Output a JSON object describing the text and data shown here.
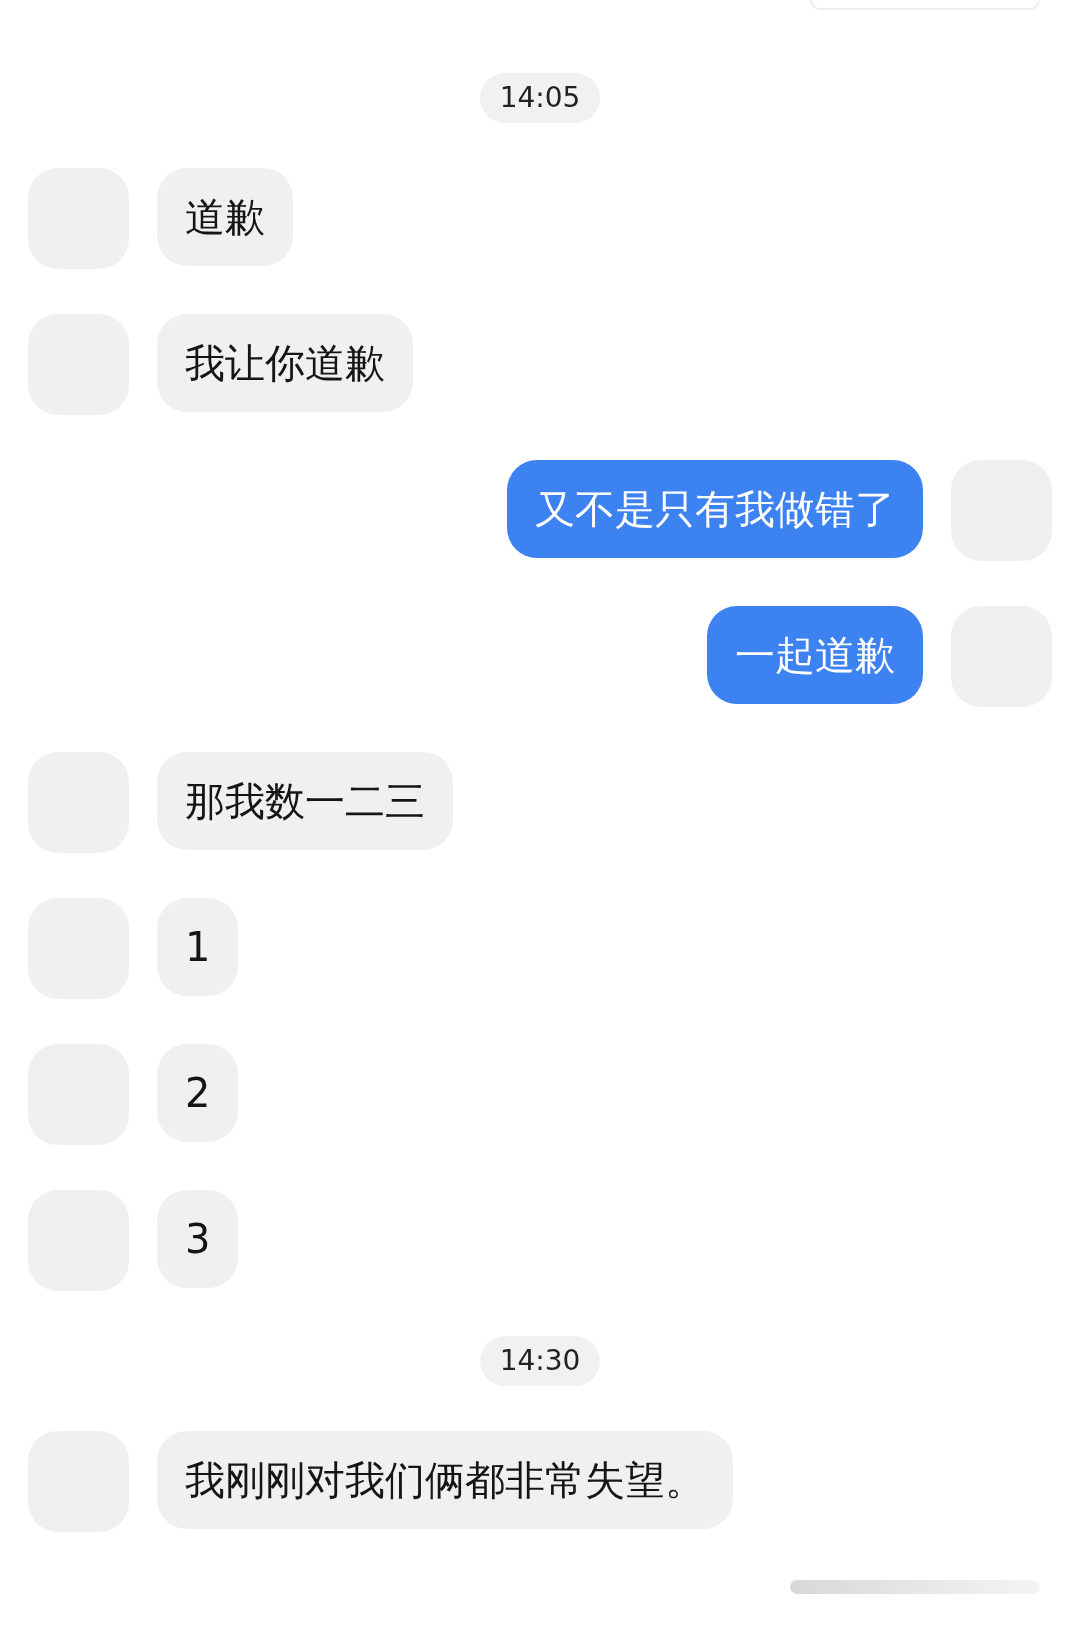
{
  "messages": [
    {
      "kind": "timestamp",
      "text": "14:05"
    },
    {
      "kind": "incoming",
      "text": "道歉"
    },
    {
      "kind": "incoming",
      "text": "我让你道歉"
    },
    {
      "kind": "outgoing",
      "text": "又不是只有我做错了"
    },
    {
      "kind": "outgoing",
      "text": "一起道歉"
    },
    {
      "kind": "incoming",
      "text": "那我数一二三"
    },
    {
      "kind": "incoming",
      "text": "1"
    },
    {
      "kind": "incoming",
      "text": "2"
    },
    {
      "kind": "incoming",
      "text": "3"
    },
    {
      "kind": "timestamp",
      "text": "14:30"
    },
    {
      "kind": "incoming",
      "text": "我刚刚对我们俩都非常失望。"
    }
  ]
}
